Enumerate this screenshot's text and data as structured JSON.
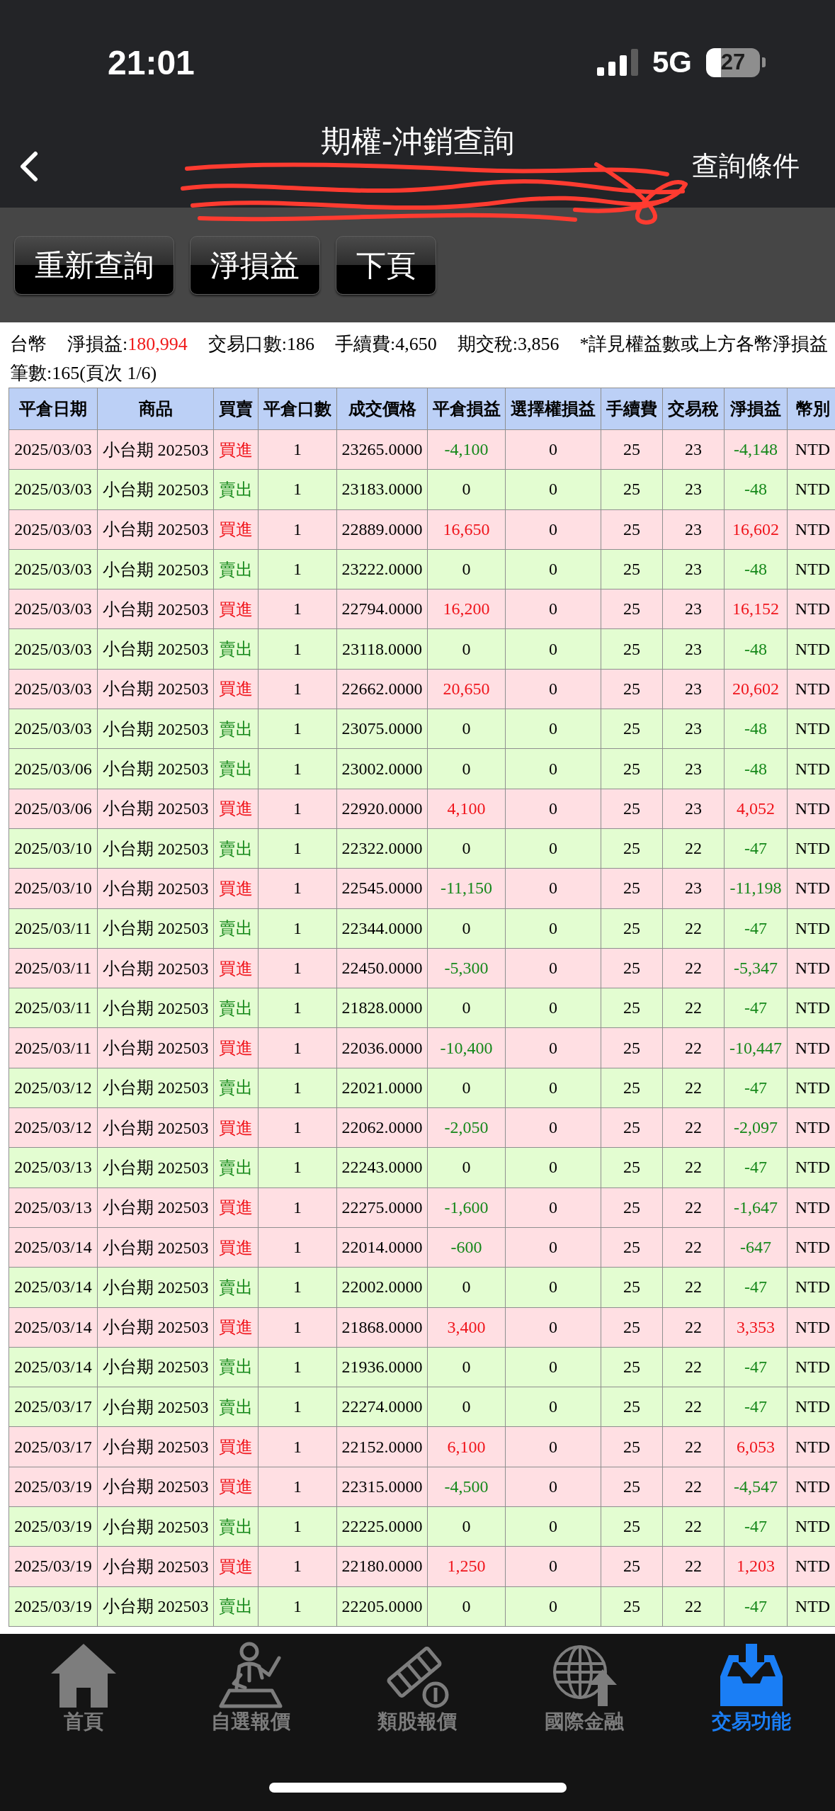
{
  "status_bar": {
    "time": "21:01",
    "network": "5G",
    "battery": "27"
  },
  "header": {
    "title": "期權-沖銷查詢",
    "action": "查詢條件"
  },
  "toolbar": {
    "buttons": [
      "重新查詢",
      "淨損益",
      "下頁"
    ]
  },
  "summary": {
    "currency": "台幣",
    "stats": [
      {
        "label": "淨損益:",
        "value": "180,994",
        "highlight": true
      },
      {
        "label": "交易口數:",
        "value": "186",
        "highlight": false
      },
      {
        "label": "手續費:",
        "value": "4,650",
        "highlight": false
      },
      {
        "label": "期交稅:",
        "value": "3,856",
        "highlight": false
      }
    ],
    "note": "*詳見權益數或上方各幣淨損益",
    "count": "筆數:165(頁次 1/6)"
  },
  "table": {
    "columns": [
      "平倉日期",
      "商品",
      "買賣",
      "平倉口數",
      "成交價格",
      "平倉損益",
      "選擇權損益",
      "手續費",
      "交易稅",
      "淨損益",
      "幣別"
    ],
    "rows": [
      {
        "kind": "buy",
        "date": "2025/03/03",
        "product": "小台期 202503",
        "side": "買進",
        "quantity": "1",
        "price": "23265.0000",
        "close_pnl": {
          "text": "-4,100",
          "kind": "loss"
        },
        "option_pnl": "0",
        "fee": "25",
        "tax": "23",
        "net_pnl": {
          "text": "-4,148",
          "kind": "loss"
        },
        "currency": "NTD"
      },
      {
        "kind": "sell",
        "date": "2025/03/03",
        "product": "小台期 202503",
        "side": "賣出",
        "quantity": "1",
        "price": "23183.0000",
        "close_pnl": {
          "text": "0",
          "kind": "flat"
        },
        "option_pnl": "0",
        "fee": "25",
        "tax": "23",
        "net_pnl": {
          "text": "-48",
          "kind": "loss"
        },
        "currency": "NTD"
      },
      {
        "kind": "buy",
        "date": "2025/03/03",
        "product": "小台期 202503",
        "side": "買進",
        "quantity": "1",
        "price": "22889.0000",
        "close_pnl": {
          "text": "16,650",
          "kind": "gain"
        },
        "option_pnl": "0",
        "fee": "25",
        "tax": "23",
        "net_pnl": {
          "text": "16,602",
          "kind": "gain"
        },
        "currency": "NTD"
      },
      {
        "kind": "sell",
        "date": "2025/03/03",
        "product": "小台期 202503",
        "side": "賣出",
        "quantity": "1",
        "price": "23222.0000",
        "close_pnl": {
          "text": "0",
          "kind": "flat"
        },
        "option_pnl": "0",
        "fee": "25",
        "tax": "23",
        "net_pnl": {
          "text": "-48",
          "kind": "loss"
        },
        "currency": "NTD"
      },
      {
        "kind": "buy",
        "date": "2025/03/03",
        "product": "小台期 202503",
        "side": "買進",
        "quantity": "1",
        "price": "22794.0000",
        "close_pnl": {
          "text": "16,200",
          "kind": "gain"
        },
        "option_pnl": "0",
        "fee": "25",
        "tax": "23",
        "net_pnl": {
          "text": "16,152",
          "kind": "gain"
        },
        "currency": "NTD"
      },
      {
        "kind": "sell",
        "date": "2025/03/03",
        "product": "小台期 202503",
        "side": "賣出",
        "quantity": "1",
        "price": "23118.0000",
        "close_pnl": {
          "text": "0",
          "kind": "flat"
        },
        "option_pnl": "0",
        "fee": "25",
        "tax": "23",
        "net_pnl": {
          "text": "-48",
          "kind": "loss"
        },
        "currency": "NTD"
      },
      {
        "kind": "buy",
        "date": "2025/03/03",
        "product": "小台期 202503",
        "side": "買進",
        "quantity": "1",
        "price": "22662.0000",
        "close_pnl": {
          "text": "20,650",
          "kind": "gain"
        },
        "option_pnl": "0",
        "fee": "25",
        "tax": "23",
        "net_pnl": {
          "text": "20,602",
          "kind": "gain"
        },
        "currency": "NTD"
      },
      {
        "kind": "sell",
        "date": "2025/03/03",
        "product": "小台期 202503",
        "side": "賣出",
        "quantity": "1",
        "price": "23075.0000",
        "close_pnl": {
          "text": "0",
          "kind": "flat"
        },
        "option_pnl": "0",
        "fee": "25",
        "tax": "23",
        "net_pnl": {
          "text": "-48",
          "kind": "loss"
        },
        "currency": "NTD"
      },
      {
        "kind": "sell",
        "date": "2025/03/06",
        "product": "小台期 202503",
        "side": "賣出",
        "quantity": "1",
        "price": "23002.0000",
        "close_pnl": {
          "text": "0",
          "kind": "flat"
        },
        "option_pnl": "0",
        "fee": "25",
        "tax": "23",
        "net_pnl": {
          "text": "-48",
          "kind": "loss"
        },
        "currency": "NTD"
      },
      {
        "kind": "buy",
        "date": "2025/03/06",
        "product": "小台期 202503",
        "side": "買進",
        "quantity": "1",
        "price": "22920.0000",
        "close_pnl": {
          "text": "4,100",
          "kind": "gain"
        },
        "option_pnl": "0",
        "fee": "25",
        "tax": "23",
        "net_pnl": {
          "text": "4,052",
          "kind": "gain"
        },
        "currency": "NTD"
      },
      {
        "kind": "sell",
        "date": "2025/03/10",
        "product": "小台期 202503",
        "side": "賣出",
        "quantity": "1",
        "price": "22322.0000",
        "close_pnl": {
          "text": "0",
          "kind": "flat"
        },
        "option_pnl": "0",
        "fee": "25",
        "tax": "22",
        "net_pnl": {
          "text": "-47",
          "kind": "loss"
        },
        "currency": "NTD"
      },
      {
        "kind": "buy",
        "date": "2025/03/10",
        "product": "小台期 202503",
        "side": "買進",
        "quantity": "1",
        "price": "22545.0000",
        "close_pnl": {
          "text": "-11,150",
          "kind": "loss"
        },
        "option_pnl": "0",
        "fee": "25",
        "tax": "23",
        "net_pnl": {
          "text": "-11,198",
          "kind": "loss"
        },
        "currency": "NTD"
      },
      {
        "kind": "sell",
        "date": "2025/03/11",
        "product": "小台期 202503",
        "side": "賣出",
        "quantity": "1",
        "price": "22344.0000",
        "close_pnl": {
          "text": "0",
          "kind": "flat"
        },
        "option_pnl": "0",
        "fee": "25",
        "tax": "22",
        "net_pnl": {
          "text": "-47",
          "kind": "loss"
        },
        "currency": "NTD"
      },
      {
        "kind": "buy",
        "date": "2025/03/11",
        "product": "小台期 202503",
        "side": "買進",
        "quantity": "1",
        "price": "22450.0000",
        "close_pnl": {
          "text": "-5,300",
          "kind": "loss"
        },
        "option_pnl": "0",
        "fee": "25",
        "tax": "22",
        "net_pnl": {
          "text": "-5,347",
          "kind": "loss"
        },
        "currency": "NTD"
      },
      {
        "kind": "sell",
        "date": "2025/03/11",
        "product": "小台期 202503",
        "side": "賣出",
        "quantity": "1",
        "price": "21828.0000",
        "close_pnl": {
          "text": "0",
          "kind": "flat"
        },
        "option_pnl": "0",
        "fee": "25",
        "tax": "22",
        "net_pnl": {
          "text": "-47",
          "kind": "loss"
        },
        "currency": "NTD"
      },
      {
        "kind": "buy",
        "date": "2025/03/11",
        "product": "小台期 202503",
        "side": "買進",
        "quantity": "1",
        "price": "22036.0000",
        "close_pnl": {
          "text": "-10,400",
          "kind": "loss"
        },
        "option_pnl": "0",
        "fee": "25",
        "tax": "22",
        "net_pnl": {
          "text": "-10,447",
          "kind": "loss"
        },
        "currency": "NTD"
      },
      {
        "kind": "sell",
        "date": "2025/03/12",
        "product": "小台期 202503",
        "side": "賣出",
        "quantity": "1",
        "price": "22021.0000",
        "close_pnl": {
          "text": "0",
          "kind": "flat"
        },
        "option_pnl": "0",
        "fee": "25",
        "tax": "22",
        "net_pnl": {
          "text": "-47",
          "kind": "loss"
        },
        "currency": "NTD"
      },
      {
        "kind": "buy",
        "date": "2025/03/12",
        "product": "小台期 202503",
        "side": "買進",
        "quantity": "1",
        "price": "22062.0000",
        "close_pnl": {
          "text": "-2,050",
          "kind": "loss"
        },
        "option_pnl": "0",
        "fee": "25",
        "tax": "22",
        "net_pnl": {
          "text": "-2,097",
          "kind": "loss"
        },
        "currency": "NTD"
      },
      {
        "kind": "sell",
        "date": "2025/03/13",
        "product": "小台期 202503",
        "side": "賣出",
        "quantity": "1",
        "price": "22243.0000",
        "close_pnl": {
          "text": "0",
          "kind": "flat"
        },
        "option_pnl": "0",
        "fee": "25",
        "tax": "22",
        "net_pnl": {
          "text": "-47",
          "kind": "loss"
        },
        "currency": "NTD"
      },
      {
        "kind": "buy",
        "date": "2025/03/13",
        "product": "小台期 202503",
        "side": "買進",
        "quantity": "1",
        "price": "22275.0000",
        "close_pnl": {
          "text": "-1,600",
          "kind": "loss"
        },
        "option_pnl": "0",
        "fee": "25",
        "tax": "22",
        "net_pnl": {
          "text": "-1,647",
          "kind": "loss"
        },
        "currency": "NTD"
      },
      {
        "kind": "buy",
        "date": "2025/03/14",
        "product": "小台期 202503",
        "side": "買進",
        "quantity": "1",
        "price": "22014.0000",
        "close_pnl": {
          "text": "-600",
          "kind": "loss"
        },
        "option_pnl": "0",
        "fee": "25",
        "tax": "22",
        "net_pnl": {
          "text": "-647",
          "kind": "loss"
        },
        "currency": "NTD"
      },
      {
        "kind": "sell",
        "date": "2025/03/14",
        "product": "小台期 202503",
        "side": "賣出",
        "quantity": "1",
        "price": "22002.0000",
        "close_pnl": {
          "text": "0",
          "kind": "flat"
        },
        "option_pnl": "0",
        "fee": "25",
        "tax": "22",
        "net_pnl": {
          "text": "-47",
          "kind": "loss"
        },
        "currency": "NTD"
      },
      {
        "kind": "buy",
        "date": "2025/03/14",
        "product": "小台期 202503",
        "side": "買進",
        "quantity": "1",
        "price": "21868.0000",
        "close_pnl": {
          "text": "3,400",
          "kind": "gain"
        },
        "option_pnl": "0",
        "fee": "25",
        "tax": "22",
        "net_pnl": {
          "text": "3,353",
          "kind": "gain"
        },
        "currency": "NTD"
      },
      {
        "kind": "sell",
        "date": "2025/03/14",
        "product": "小台期 202503",
        "side": "賣出",
        "quantity": "1",
        "price": "21936.0000",
        "close_pnl": {
          "text": "0",
          "kind": "flat"
        },
        "option_pnl": "0",
        "fee": "25",
        "tax": "22",
        "net_pnl": {
          "text": "-47",
          "kind": "loss"
        },
        "currency": "NTD"
      },
      {
        "kind": "sell",
        "date": "2025/03/17",
        "product": "小台期 202503",
        "side": "賣出",
        "quantity": "1",
        "price": "22274.0000",
        "close_pnl": {
          "text": "0",
          "kind": "flat"
        },
        "option_pnl": "0",
        "fee": "25",
        "tax": "22",
        "net_pnl": {
          "text": "-47",
          "kind": "loss"
        },
        "currency": "NTD"
      },
      {
        "kind": "buy",
        "date": "2025/03/17",
        "product": "小台期 202503",
        "side": "買進",
        "quantity": "1",
        "price": "22152.0000",
        "close_pnl": {
          "text": "6,100",
          "kind": "gain"
        },
        "option_pnl": "0",
        "fee": "25",
        "tax": "22",
        "net_pnl": {
          "text": "6,053",
          "kind": "gain"
        },
        "currency": "NTD"
      },
      {
        "kind": "buy",
        "date": "2025/03/19",
        "product": "小台期 202503",
        "side": "買進",
        "quantity": "1",
        "price": "22315.0000",
        "close_pnl": {
          "text": "-4,500",
          "kind": "loss"
        },
        "option_pnl": "0",
        "fee": "25",
        "tax": "22",
        "net_pnl": {
          "text": "-4,547",
          "kind": "loss"
        },
        "currency": "NTD"
      },
      {
        "kind": "sell",
        "date": "2025/03/19",
        "product": "小台期 202503",
        "side": "賣出",
        "quantity": "1",
        "price": "22225.0000",
        "close_pnl": {
          "text": "0",
          "kind": "flat"
        },
        "option_pnl": "0",
        "fee": "25",
        "tax": "22",
        "net_pnl": {
          "text": "-47",
          "kind": "loss"
        },
        "currency": "NTD"
      },
      {
        "kind": "buy",
        "date": "2025/03/19",
        "product": "小台期 202503",
        "side": "買進",
        "quantity": "1",
        "price": "22180.0000",
        "close_pnl": {
          "text": "1,250",
          "kind": "gain"
        },
        "option_pnl": "0",
        "fee": "25",
        "tax": "22",
        "net_pnl": {
          "text": "1,203",
          "kind": "gain"
        },
        "currency": "NTD"
      },
      {
        "kind": "sell",
        "date": "2025/03/19",
        "product": "小台期 202503",
        "side": "賣出",
        "quantity": "1",
        "price": "22205.0000",
        "close_pnl": {
          "text": "0",
          "kind": "flat"
        },
        "option_pnl": "0",
        "fee": "25",
        "tax": "22",
        "net_pnl": {
          "text": "-47",
          "kind": "loss"
        },
        "currency": "NTD"
      }
    ]
  },
  "nav": {
    "tabs": [
      {
        "label": "首頁",
        "selected": false
      },
      {
        "label": "自選報價",
        "selected": false
      },
      {
        "label": "類股報價",
        "selected": false
      },
      {
        "label": "國際金融",
        "selected": false
      },
      {
        "label": "交易功能",
        "selected": true
      }
    ]
  }
}
